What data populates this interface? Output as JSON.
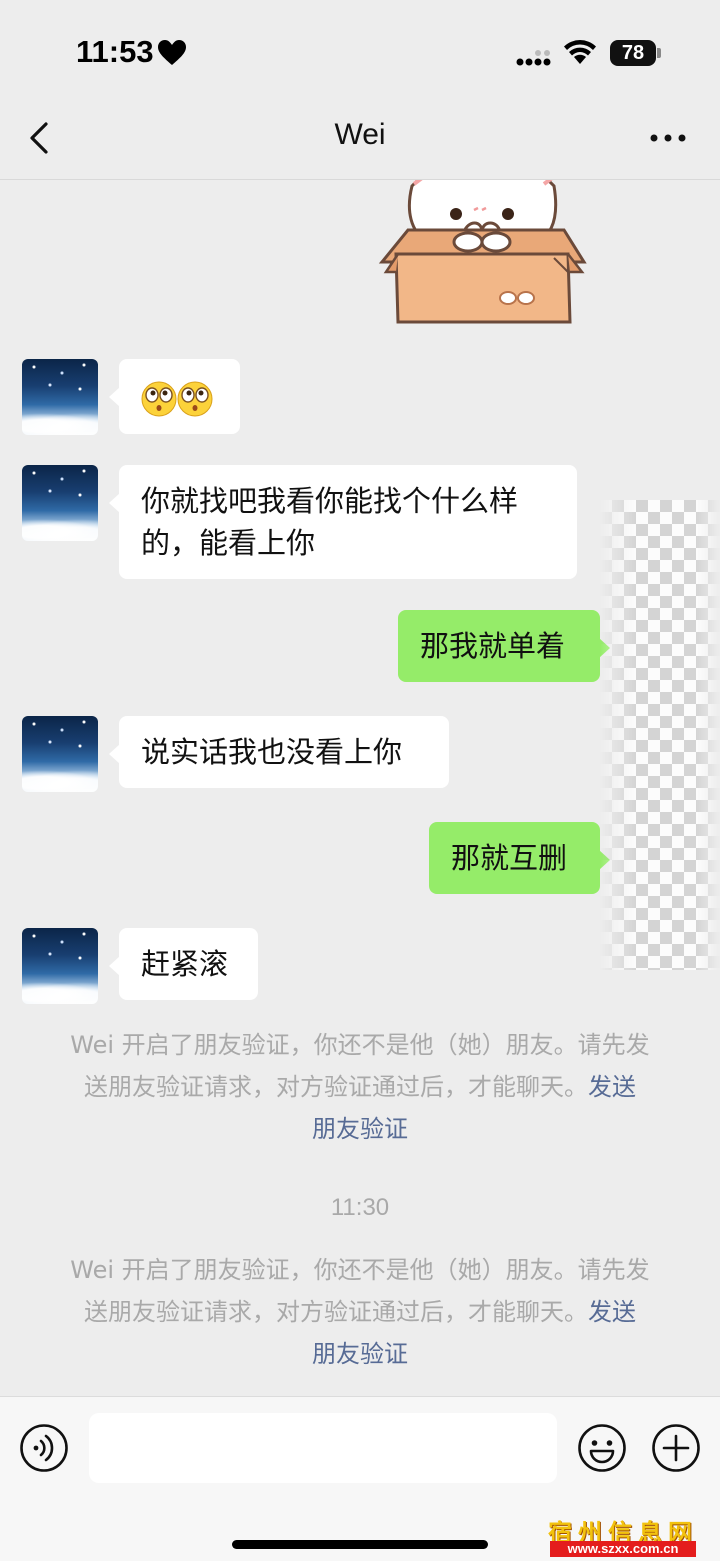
{
  "status_bar": {
    "time": "11:53",
    "battery": "78",
    "icons": [
      "heart-icon",
      "signal-icon",
      "wifi-icon",
      "battery-icon"
    ]
  },
  "header": {
    "title": "Wei",
    "back_icon": "chevron-left-icon",
    "more_icon": "more-dots-icon"
  },
  "messages": [
    {
      "side": "out",
      "type": "sticker",
      "sticker": "cat-in-box-sticker"
    },
    {
      "side": "in",
      "type": "emoji",
      "emojis": [
        "staring-eyes-emoji",
        "staring-eyes-emoji"
      ]
    },
    {
      "side": "in",
      "type": "text",
      "line1": "你就找吧我看你能找个什么样",
      "line2": "的，能看上你"
    },
    {
      "side": "out",
      "type": "text",
      "text": "那我就单着"
    },
    {
      "side": "in",
      "type": "text",
      "text": "说实话我也没看上你"
    },
    {
      "side": "out",
      "type": "text",
      "text": "那就互删"
    },
    {
      "side": "in",
      "type": "text",
      "text": "赶紧滚"
    }
  ],
  "notices": [
    {
      "line1": "Wei 开启了朋友验证，你还不是他（她）朋友。请先发",
      "line2": "送朋友验证请求，对方验证通过后，才能聊天。",
      "link_part1": "发送",
      "link_part2": "朋友验证"
    },
    {
      "line1": "Wei 开启了朋友验证，你还不是他（她）朋友。请先发",
      "line2": "送朋友验证请求，对方验证通过后，才能聊天。",
      "link_part1": "发送",
      "link_part2": "朋友验证"
    }
  ],
  "timestamp": "11:30",
  "input_bar": {
    "placeholder": "",
    "icons": [
      "voice-icon",
      "emoji-icon",
      "plus-icon"
    ]
  },
  "watermark": {
    "title": "宿州信息网",
    "url": "www.szxx.com.cn"
  },
  "colors": {
    "background": "#ededed",
    "incoming_bubble": "#ffffff",
    "outgoing_bubble": "#95ec69",
    "link": "#576b95",
    "notice_text": "#a9a9a9"
  }
}
